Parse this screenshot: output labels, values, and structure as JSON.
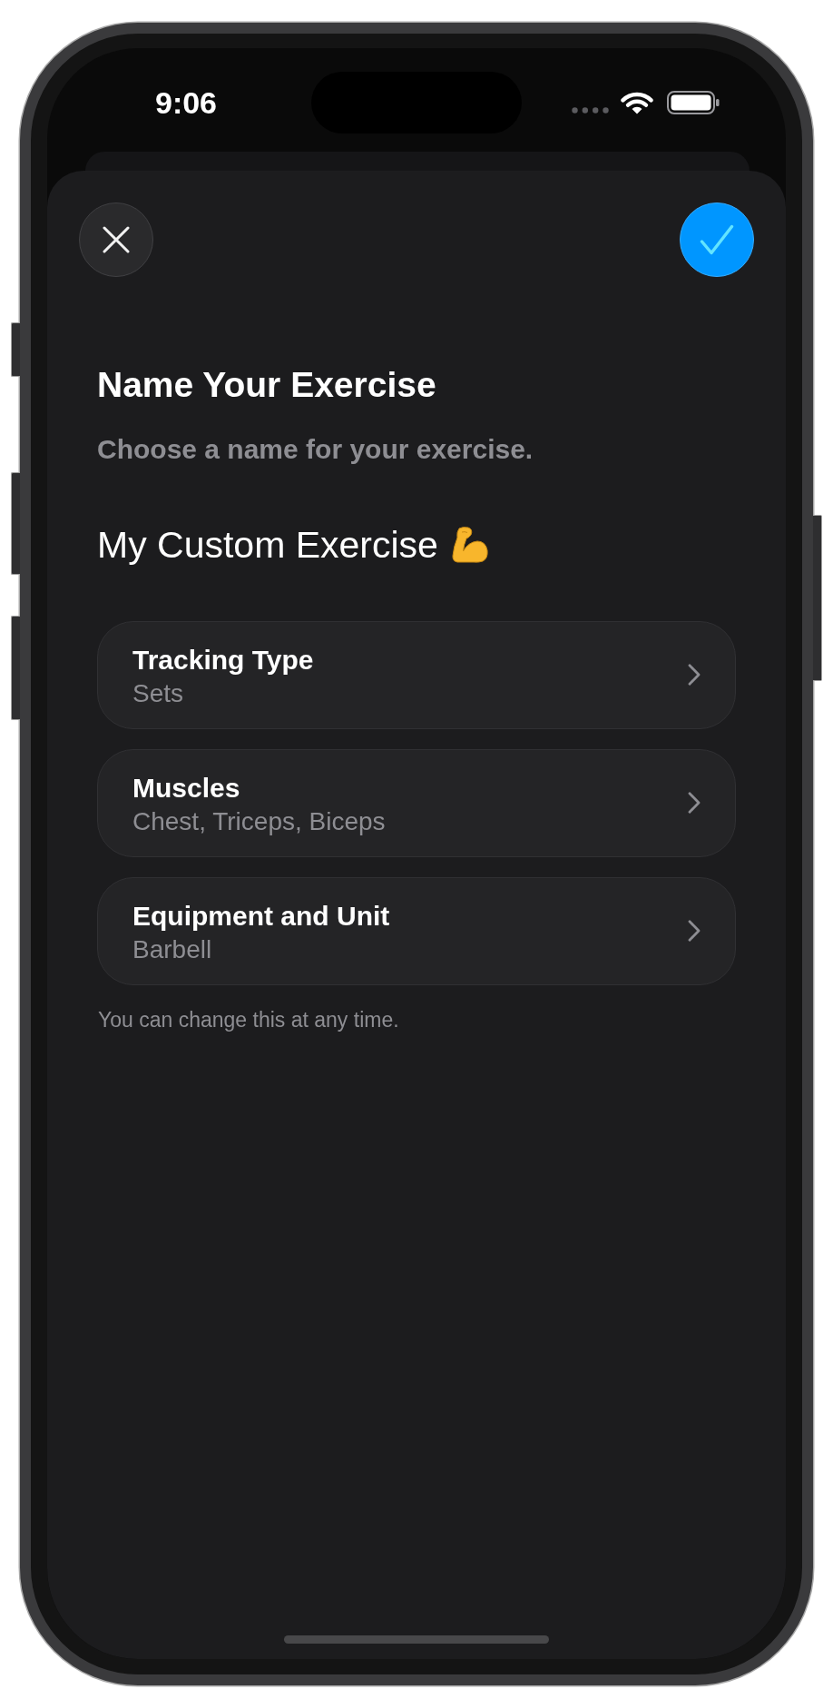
{
  "status_bar": {
    "time": "9:06"
  },
  "sheet": {
    "title": "Name Your Exercise",
    "subtitle": "Choose a name for your exercise.",
    "name_field": {
      "value": "My Custom Exercise"
    },
    "options": [
      {
        "label": "Tracking Type",
        "value": "Sets"
      },
      {
        "label": "Muscles",
        "value": "Chest, Triceps, Biceps"
      },
      {
        "label": "Equipment and Unit",
        "value": "Barbell"
      }
    ],
    "footnote": "You can change this at any time."
  }
}
